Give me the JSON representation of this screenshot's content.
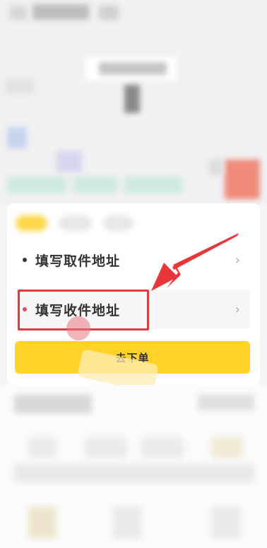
{
  "delivery": {
    "pickup_label": "填写取件地址",
    "dropoff_label": "填写收件地址",
    "order_button_label": "去下单",
    "chevron": "›"
  },
  "colors": {
    "accent_yellow": "#ffd22a",
    "highlight_red": "#e8363a",
    "pickup_dot": "#333333",
    "dropoff_dot": "#e44b5a"
  },
  "icons": [
    "chevron-right-icon",
    "red-arrow-annotation"
  ]
}
